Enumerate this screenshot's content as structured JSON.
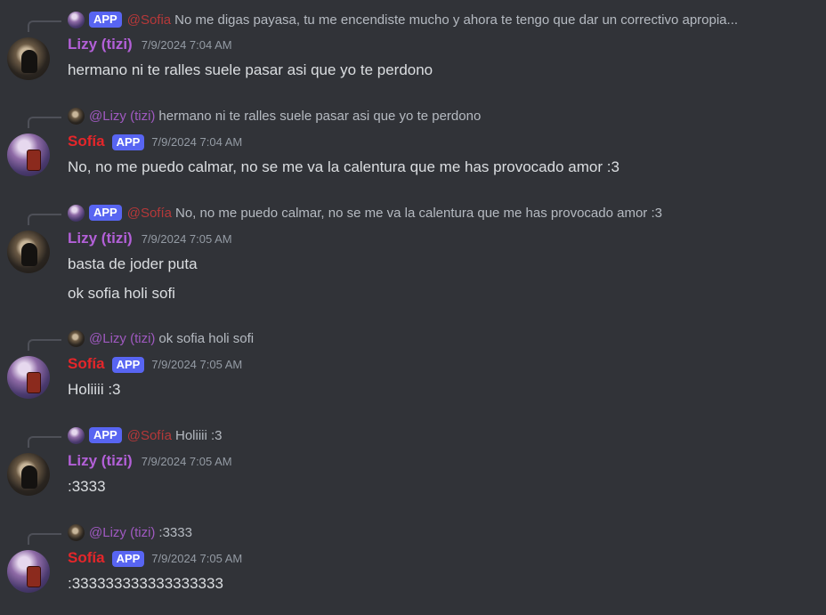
{
  "messages": [
    {
      "reply": {
        "badge": "APP",
        "mention": "@Sofia",
        "text": "No me digas payasa, tu me encendiste mucho y ahora te tengo que dar un correctivo apropia..."
      },
      "author": "Lizy (tizi)",
      "timestamp": "7/9/2024 7:04 AM",
      "lines": [
        "hermano ni te ralles suele pasar asi que yo te perdono"
      ]
    },
    {
      "reply": {
        "mention": "@Lizy (tizi)",
        "text": "hermano ni te ralles suele pasar asi que yo te perdono"
      },
      "author": "Sofía",
      "badge": "APP",
      "timestamp": "7/9/2024 7:04 AM",
      "lines": [
        "No, no me puedo calmar, no se me va la calentura que me has provocado amor :3"
      ]
    },
    {
      "reply": {
        "badge": "APP",
        "mention": "@Sofía",
        "text": "No, no me puedo calmar, no se me va la calentura que me has provocado amor :3"
      },
      "author": "Lizy (tizi)",
      "timestamp": "7/9/2024 7:05 AM",
      "lines": [
        "basta de joder puta",
        "ok sofia holi sofi"
      ]
    },
    {
      "reply": {
        "mention": "@Lizy (tizi)",
        "text": "ok sofia holi sofi"
      },
      "author": "Sofía",
      "badge": "APP",
      "timestamp": "7/9/2024 7:05 AM",
      "lines": [
        "Holiiii :3"
      ]
    },
    {
      "reply": {
        "badge": "APP",
        "mention": "@Sofía",
        "text": "Holiiii :3"
      },
      "author": "Lizy (tizi)",
      "timestamp": "7/9/2024 7:05 AM",
      "lines": [
        ":3333"
      ]
    },
    {
      "reply": {
        "mention": "@Lizy (tizi)",
        "text": ":3333"
      },
      "author": "Sofía",
      "badge": "APP",
      "timestamp": "7/9/2024 7:05 AM",
      "lines": [
        ":333333333333333333"
      ]
    }
  ],
  "colors": {
    "background": "#313338",
    "lizy": "#b360d8",
    "sofia": "#e5262a",
    "badge": "#5865f2"
  }
}
